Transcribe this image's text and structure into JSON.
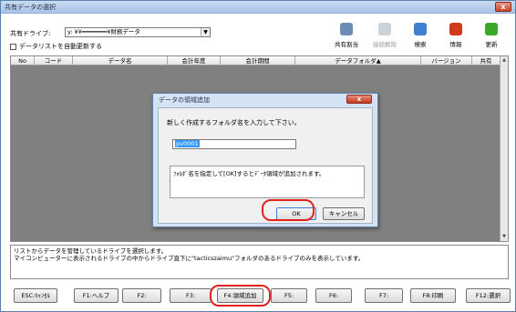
{
  "window": {
    "title": "共有データの選択",
    "close_glyph": "x"
  },
  "drive": {
    "label": "共有ドライブ:",
    "value": "y: ¥¥━━━━━━━¥財務データ",
    "arrow": "▼"
  },
  "auto_update": {
    "label": "データリストを自動更新する",
    "checked": false
  },
  "toolbar": [
    {
      "label": "共有割当",
      "icon": "share-assign-icon",
      "color": "#6d8cb5",
      "disabled": false
    },
    {
      "label": "接続解除",
      "icon": "disconnect-icon",
      "color": "#9aa6b4",
      "disabled": true
    },
    {
      "label": "検索",
      "icon": "search-icon",
      "color": "#3e7fd0",
      "disabled": false
    },
    {
      "label": "情報",
      "icon": "info-icon",
      "color": "#d23a1e",
      "disabled": false
    },
    {
      "label": "更新",
      "icon": "refresh-icon",
      "color": "#3aa82a",
      "disabled": false
    }
  ],
  "grid": {
    "columns": [
      "No",
      "コード",
      "データ名",
      "会計年度",
      "会計期間",
      "データフォルダ▲",
      "バージョン",
      "共有"
    ],
    "scroll_up": "▲",
    "scroll_down": "▼"
  },
  "info_lines": [
    "リストからデータを管理しているドライブを選択します。",
    "マイコンピューターに表示されるドライブの中からドライブ直下に\"tacticszaimu\"フォルダのあるドライブのみを表示しています。"
  ],
  "fkeys": [
    {
      "label": "ESC:ｷｬﾝｾﾙ",
      "highlight": false
    },
    {
      "label": "F1:ヘルプ",
      "highlight": false
    },
    {
      "label": "F2:",
      "highlight": false
    },
    {
      "label": "F3:",
      "highlight": false
    },
    {
      "label": "F4:領域追加",
      "highlight": true
    },
    {
      "label": "F5:",
      "highlight": false
    },
    {
      "label": "F6:",
      "highlight": false
    },
    {
      "label": "F7:",
      "highlight": false
    },
    {
      "label": "F8:印刷",
      "highlight": false
    },
    {
      "label": "F12:選択",
      "highlight": false
    }
  ],
  "dialog": {
    "title": "データの領域追加",
    "close_glyph": "x",
    "prompt": "新しく作成するフォルダ名を入力して下さい。",
    "input_value": "pv0001",
    "note": "ﾌｫﾙﾀﾞ名を指定して[OK]するとﾃﾞｰﾀ領域が追加されます。",
    "ok_label": "OK",
    "cancel_label": "キャンセル"
  },
  "colors": {
    "highlight_ring": "#e32020",
    "grid_bg": "#808080"
  }
}
